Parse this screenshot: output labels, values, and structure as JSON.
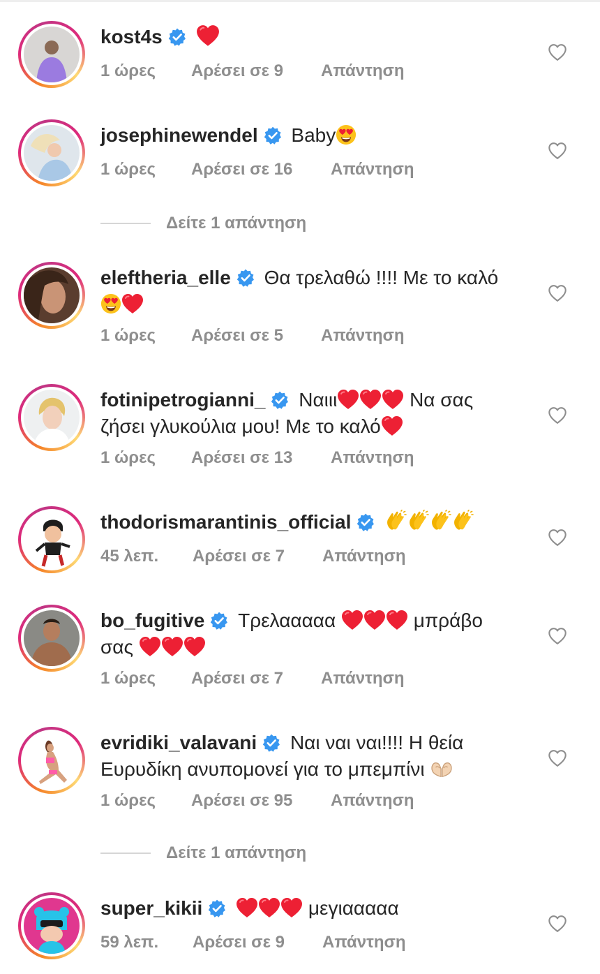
{
  "comments": [
    {
      "username": "kost4s",
      "text": "",
      "time": "1 ώρες",
      "likes": "Αρέσει σε 9",
      "reply": "Απάντηση",
      "emojis": [
        "heart"
      ]
    },
    {
      "username": "josephinewendel",
      "text": "Baby",
      "time": "1 ώρες",
      "likes": "Αρέσει σε 16",
      "reply": "Απάντηση",
      "emojis": [
        "heart-eyes"
      ]
    },
    {
      "username": "eleftheria_elle",
      "text": "Θα τρελαθώ !!!! Με το καλό",
      "time": "1 ώρες",
      "likes": "Αρέσει σε 5",
      "reply": "Απάντηση",
      "emojis": [
        "heart-eyes",
        "heart"
      ]
    },
    {
      "username": "fotinipetrogianni_",
      "text_a": "Ναιιι",
      "text_b": "Να σας ζήσει γλυκούλια μου! Με το καλό",
      "time": "1 ώρες",
      "likes": "Αρέσει σε 13",
      "reply": "Απάντηση",
      "emojis": [
        "heart",
        "heart",
        "heart",
        "heart"
      ]
    },
    {
      "username": "thodorismarantinis_official",
      "text": "",
      "time": "45 λεπ.",
      "likes": "Αρέσει σε 7",
      "reply": "Απάντηση",
      "emojis": [
        "clap",
        "clap",
        "clap",
        "clap"
      ]
    },
    {
      "username": "bo_fugitive",
      "text_a": "Τρελααααα",
      "text_b": "μπράβο σας",
      "time": "1 ώρες",
      "likes": "Αρέσει σε 7",
      "reply": "Απάντηση",
      "emojis": [
        "heart",
        "heart",
        "heart",
        "heart",
        "heart",
        "heart"
      ]
    },
    {
      "username": "evridiki_valavani",
      "text": "Ναι ναι ναι!!!! Η θεία Ευρυδίκη ανυπομονεί για το μπεμπίνι",
      "time": "1 ώρες",
      "likes": "Αρέσει σε 95",
      "reply": "Απάντηση",
      "emojis": [
        "heart-hands"
      ]
    },
    {
      "username": "super_kikii",
      "text": "μεγιααααα",
      "time": "59 λεπ.",
      "likes": "Αρέσει σε 9",
      "reply": "Απάντηση",
      "emojis": [
        "heart",
        "heart",
        "heart"
      ]
    }
  ],
  "view_replies": [
    "Δείτε 1 απάντηση",
    "Δείτε 1 απάντηση"
  ],
  "icons": {
    "verified": "verified-badge-icon",
    "like": "heart-outline-icon"
  },
  "colors": {
    "verified": "#3897f0",
    "heart": "#ed4956",
    "meta": "#8e8e8e"
  }
}
